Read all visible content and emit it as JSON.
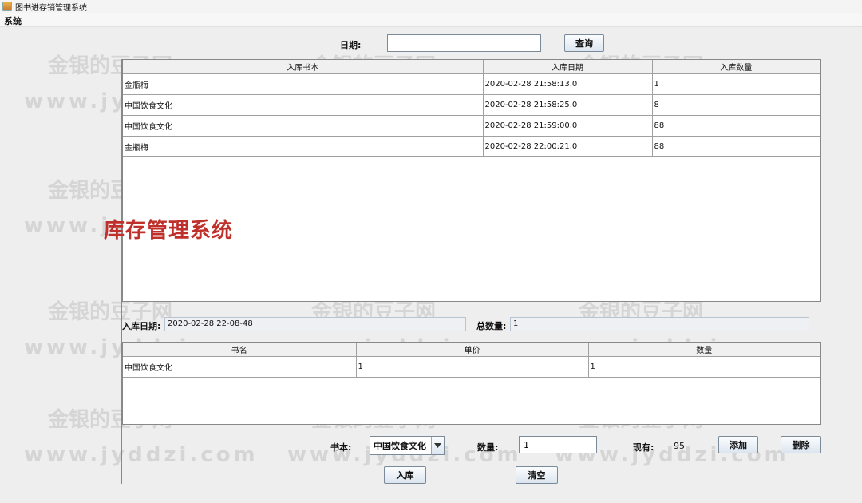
{
  "window": {
    "title": "图书进存销管理系统"
  },
  "menu": {
    "system": "系统"
  },
  "search": {
    "date_label": "日期:",
    "date_value": "",
    "query_button": "查询"
  },
  "stock_table": {
    "headers": [
      "入库书本",
      "入库日期",
      "入库数量"
    ],
    "rows": [
      [
        "金瓶梅",
        "2020-02-28 21:58:13.0",
        "1"
      ],
      [
        "中国饮食文化",
        "2020-02-28 21:58:25.0",
        "8"
      ],
      [
        "中国饮食文化",
        "2020-02-28 21:59:00.0",
        "88"
      ],
      [
        "金瓶梅",
        "2020-02-28 22:00:21.0",
        "88"
      ]
    ]
  },
  "banner": "库存管理系统",
  "watermark": {
    "cn": "金银的豆子网",
    "url": "www.jyddzi.com"
  },
  "entry": {
    "date_label": "入库日期:",
    "date_value": "2020-02-28 22-08-48",
    "total_label": "总数量:",
    "total_value": "1"
  },
  "detail_table": {
    "headers": [
      "书名",
      "单价",
      "数量"
    ],
    "rows": [
      [
        "中国饮食文化",
        "1",
        "1"
      ]
    ]
  },
  "form": {
    "book_label": "书本:",
    "book_selected": "中国饮食文化",
    "qty_label": "数量:",
    "qty_value": "1",
    "stock_label": "现有:",
    "stock_value": "95",
    "add_button": "添加",
    "delete_button": "删除",
    "stockin_button": "入库",
    "clear_button": "清空"
  }
}
